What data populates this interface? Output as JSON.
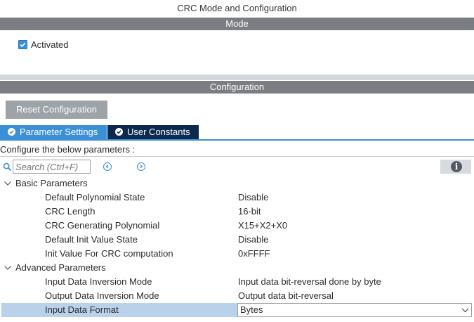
{
  "window": {
    "title": "CRC Mode and Configuration"
  },
  "mode": {
    "header": "Mode",
    "activated_label": "Activated",
    "activated_checked": true
  },
  "configuration": {
    "header": "Configuration",
    "reset_button": "Reset Configuration",
    "tabs": [
      {
        "label": "Parameter Settings",
        "active": true
      },
      {
        "label": "User Constants",
        "active": false
      }
    ],
    "instructions": "Configure the below parameters :",
    "search": {
      "placeholder": "Search (Ctrl+F)",
      "value": ""
    },
    "groups": [
      {
        "label": "Basic Parameters",
        "params": [
          {
            "name": "Default Polynomial State",
            "value": "Disable"
          },
          {
            "name": "CRC Length",
            "value": "16-bit"
          },
          {
            "name": "CRC Generating Polynomial",
            "value": "X15+X2+X0"
          },
          {
            "name": "Default Init Value State",
            "value": "Disable"
          },
          {
            "name": "Init Value For CRC computation",
            "value": "0xFFFF"
          }
        ]
      },
      {
        "label": "Advanced Parameters",
        "params": [
          {
            "name": "Input Data Inversion Mode",
            "value": "Input data bit-reversal done by byte"
          },
          {
            "name": "Output Data Inversion Mode",
            "value": "Output data bit-reversal"
          },
          {
            "name": "Input Data Format",
            "value": "Bytes",
            "selected": true
          }
        ]
      }
    ]
  },
  "colors": {
    "accent": "#3b8fd6",
    "header_band": "#7a7e82",
    "active_tab": "#3b8fd6",
    "inactive_tab": "#0d2a4e",
    "selected_row": "#b9d2ea"
  },
  "icons": {
    "checkbox": "checkmark-icon",
    "tab_status": "check-circle-icon",
    "search": "search-icon",
    "prev": "chevron-left-circle-icon",
    "next": "chevron-right-circle-icon",
    "info": "info-icon",
    "group_toggle": "chevron-down-icon",
    "dropdown": "chevron-down-icon"
  }
}
